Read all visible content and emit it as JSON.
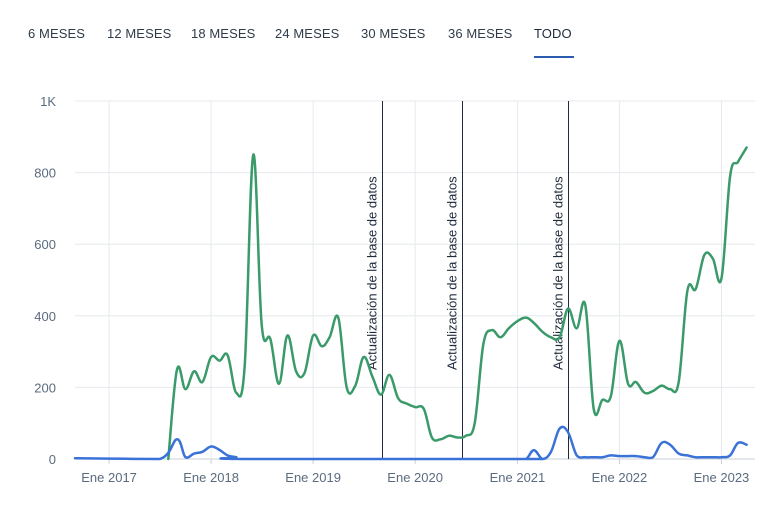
{
  "tabs": [
    {
      "label": "6 MESES",
      "active": false
    },
    {
      "label": "12 MESES",
      "active": false
    },
    {
      "label": "18 MESES",
      "active": false
    },
    {
      "label": "24 MESES",
      "active": false
    },
    {
      "label": "30 MESES",
      "active": false
    },
    {
      "label": "36 MESES",
      "active": false
    },
    {
      "label": "TODO",
      "active": true
    }
  ],
  "chart_data": {
    "type": "line",
    "title": "",
    "xlabel": "",
    "ylabel": "",
    "ylim": [
      0,
      1000
    ],
    "yticks": [
      {
        "value": 0,
        "label": "0"
      },
      {
        "value": 200,
        "label": "200"
      },
      {
        "value": 400,
        "label": "400"
      },
      {
        "value": 600,
        "label": "600"
      },
      {
        "value": 800,
        "label": "800"
      },
      {
        "value": 1000,
        "label": "1K"
      }
    ],
    "xlim": [
      "2016-09-01",
      "2023-05-01"
    ],
    "xticks": [
      {
        "date": "2017-01-01",
        "label": "Ene 2017"
      },
      {
        "date": "2018-01-01",
        "label": "Ene 2018"
      },
      {
        "date": "2019-01-01",
        "label": "Ene 2019"
      },
      {
        "date": "2020-01-01",
        "label": "Ene 2020"
      },
      {
        "date": "2021-01-01",
        "label": "Ene 2021"
      },
      {
        "date": "2022-01-01",
        "label": "Ene 2022"
      },
      {
        "date": "2023-01-01",
        "label": "Ene 2023"
      }
    ],
    "grid": true,
    "legend": "none",
    "annotations": [
      {
        "date": "2019-09-05",
        "label": "Actualización de la base de datos"
      },
      {
        "date": "2020-06-15",
        "label": "Actualización de la base de datos"
      },
      {
        "date": "2021-07-01",
        "label": "Actualización de la base de datos"
      }
    ],
    "series": [
      {
        "color": "#3a9a6a",
        "points": [
          [
            "2017-08-01",
            0
          ],
          [
            "2017-09-01",
            250
          ],
          [
            "2017-10-01",
            195
          ],
          [
            "2017-11-01",
            245
          ],
          [
            "2017-12-01",
            215
          ],
          [
            "2018-01-01",
            285
          ],
          [
            "2018-02-01",
            275
          ],
          [
            "2018-03-01",
            290
          ],
          [
            "2018-04-01",
            185
          ],
          [
            "2018-05-01",
            260
          ],
          [
            "2018-06-01",
            850
          ],
          [
            "2018-07-01",
            375
          ],
          [
            "2018-08-01",
            335
          ],
          [
            "2018-09-01",
            210
          ],
          [
            "2018-10-01",
            345
          ],
          [
            "2018-11-01",
            245
          ],
          [
            "2018-12-01",
            240
          ],
          [
            "2019-01-01",
            345
          ],
          [
            "2019-02-01",
            315
          ],
          [
            "2019-03-01",
            340
          ],
          [
            "2019-04-01",
            395
          ],
          [
            "2019-05-01",
            200
          ],
          [
            "2019-06-01",
            205
          ],
          [
            "2019-07-01",
            285
          ],
          [
            "2019-08-01",
            230
          ],
          [
            "2019-09-01",
            180
          ],
          [
            "2019-10-01",
            235
          ],
          [
            "2019-11-01",
            170
          ],
          [
            "2019-12-01",
            155
          ],
          [
            "2020-01-01",
            145
          ],
          [
            "2020-02-01",
            140
          ],
          [
            "2020-03-01",
            60
          ],
          [
            "2020-04-01",
            55
          ],
          [
            "2020-05-01",
            65
          ],
          [
            "2020-06-01",
            60
          ],
          [
            "2020-07-01",
            65
          ],
          [
            "2020-08-01",
            100
          ],
          [
            "2020-09-01",
            320
          ],
          [
            "2020-10-01",
            360
          ],
          [
            "2020-11-01",
            340
          ],
          [
            "2020-12-01",
            365
          ],
          [
            "2021-01-01",
            385
          ],
          [
            "2021-02-01",
            395
          ],
          [
            "2021-03-01",
            380
          ],
          [
            "2021-04-01",
            355
          ],
          [
            "2021-05-01",
            340
          ],
          [
            "2021-06-01",
            340
          ],
          [
            "2021-07-01",
            420
          ],
          [
            "2021-08-01",
            365
          ],
          [
            "2021-09-01",
            430
          ],
          [
            "2021-10-01",
            140
          ],
          [
            "2021-11-01",
            165
          ],
          [
            "2021-12-01",
            175
          ],
          [
            "2022-01-01",
            330
          ],
          [
            "2022-02-01",
            210
          ],
          [
            "2022-03-01",
            215
          ],
          [
            "2022-04-01",
            185
          ],
          [
            "2022-05-01",
            190
          ],
          [
            "2022-06-01",
            205
          ],
          [
            "2022-07-01",
            195
          ],
          [
            "2022-08-01",
            215
          ],
          [
            "2022-09-01",
            470
          ],
          [
            "2022-10-01",
            475
          ],
          [
            "2022-11-01",
            570
          ],
          [
            "2022-12-01",
            560
          ],
          [
            "2023-01-01",
            505
          ],
          [
            "2023-02-01",
            790
          ],
          [
            "2023-03-01",
            830
          ],
          [
            "2023-04-01",
            870
          ]
        ]
      },
      {
        "color": "#3a72d8",
        "points": [
          [
            "2016-09-01",
            2
          ],
          [
            "2017-01-01",
            1
          ],
          [
            "2017-07-01",
            0
          ],
          [
            "2017-09-01",
            55
          ],
          [
            "2017-10-01",
            5
          ],
          [
            "2017-11-01",
            15
          ],
          [
            "2017-12-01",
            20
          ],
          [
            "2018-01-01",
            35
          ],
          [
            "2018-02-01",
            25
          ],
          [
            "2018-03-01",
            10
          ],
          [
            "2018-04-01",
            5
          ],
          [
            "2018-05-01",
            0
          ],
          [
            "2021-01-01",
            0
          ],
          [
            "2021-02-01",
            0
          ],
          [
            "2021-03-01",
            25
          ],
          [
            "2021-04-01",
            0
          ],
          [
            "2021-05-01",
            20
          ],
          [
            "2021-06-01",
            85
          ],
          [
            "2021-07-01",
            75
          ],
          [
            "2021-08-01",
            10
          ],
          [
            "2021-09-01",
            5
          ],
          [
            "2021-10-01",
            5
          ],
          [
            "2021-11-01",
            5
          ],
          [
            "2021-12-01",
            10
          ],
          [
            "2022-01-01",
            8
          ],
          [
            "2022-02-01",
            8
          ],
          [
            "2022-03-01",
            8
          ],
          [
            "2022-04-01",
            5
          ],
          [
            "2022-05-01",
            5
          ],
          [
            "2022-06-01",
            45
          ],
          [
            "2022-07-01",
            40
          ],
          [
            "2022-08-01",
            15
          ],
          [
            "2022-09-01",
            10
          ],
          [
            "2022-10-01",
            5
          ],
          [
            "2022-11-01",
            5
          ],
          [
            "2022-12-01",
            5
          ],
          [
            "2023-01-01",
            5
          ],
          [
            "2023-02-01",
            10
          ],
          [
            "2023-03-01",
            45
          ],
          [
            "2023-04-01",
            40
          ]
        ]
      }
    ]
  }
}
